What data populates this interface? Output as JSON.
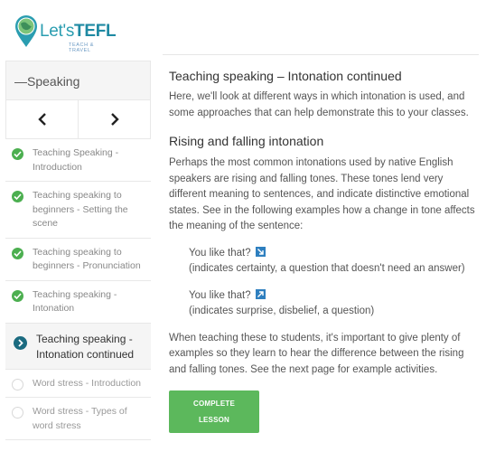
{
  "brand": {
    "name_part1": "Let's",
    "name_part2": "TEFL",
    "tagline": "TEACH & TRAVEL"
  },
  "sidebar": {
    "title": "—Speaking",
    "items": [
      {
        "label": "Teaching Speaking - Introduction",
        "status": "complete"
      },
      {
        "label": "Teaching speaking to beginners - Setting the scene",
        "status": "complete"
      },
      {
        "label": "Teaching speaking to beginners - Pronunciation",
        "status": "complete"
      },
      {
        "label": "Teaching speaking - Intonation",
        "status": "complete"
      },
      {
        "label": "Teaching speaking - Intonation continued",
        "status": "current"
      },
      {
        "label": "Word stress - Introduction",
        "status": "incomplete"
      },
      {
        "label": "Word stress - Types of word stress",
        "status": "incomplete"
      }
    ]
  },
  "lesson": {
    "title": "Teaching speaking – Intonation continued",
    "intro": "Here, we'll look at different ways in which intonation is used, and some approaches that can help demonstrate this to your classes.",
    "section_heading": "Rising and falling intonation",
    "section_body": "Perhaps the most common intonations used by native English speakers are rising and falling tones. These tones lend very different meaning to sentences, and indicate distinctive emotional states. See in the following examples how a change in tone affects the meaning of the sentence:",
    "examples": [
      {
        "phrase": "You like that?",
        "tone_icon": "falling-arrow-icon",
        "note": "(indicates certainty, a question that doesn't need an answer)"
      },
      {
        "phrase": "You like that?",
        "tone_icon": "rising-arrow-icon",
        "note": "(indicates surprise, disbelief, a question)"
      }
    ],
    "closing": "When teaching these to students, it's important to give plenty of examples so they learn to hear the difference between the rising and falling tones. See the next page for example activities.",
    "complete_button": "COMPLETE LESSON"
  },
  "colors": {
    "brand": "#1f8aa3",
    "complete": "#4caf50",
    "button": "#5cb85c",
    "current": "#1b6b80",
    "tone_icon": "#2e7fbf"
  }
}
